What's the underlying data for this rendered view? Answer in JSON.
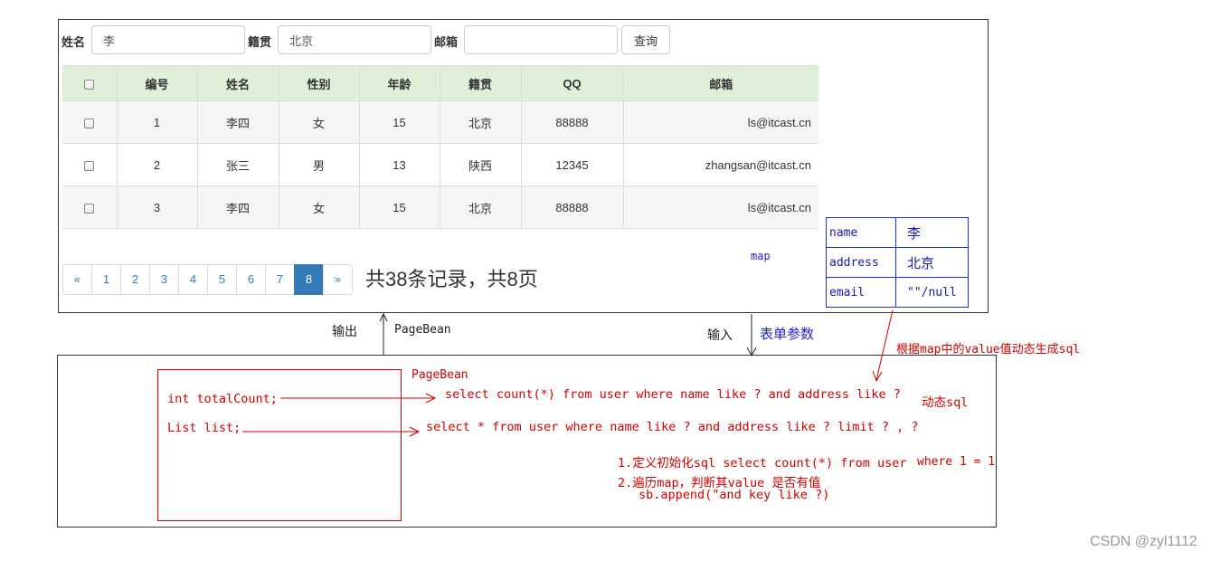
{
  "search": {
    "name_label": "姓名",
    "name_value": "李",
    "address_label": "籍贯",
    "address_value": "北京",
    "email_label": "邮箱",
    "email_value": "",
    "query_button": "查询"
  },
  "table": {
    "headers": [
      "编号",
      "姓名",
      "性别",
      "年龄",
      "籍贯",
      "QQ",
      "邮箱"
    ],
    "rows": [
      [
        "1",
        "李四",
        "女",
        "15",
        "北京",
        "88888",
        "ls@itcast.cn"
      ],
      [
        "2",
        "张三",
        "男",
        "13",
        "陕西",
        "12345",
        "zhangsan@itcast.cn"
      ],
      [
        "3",
        "李四",
        "女",
        "15",
        "北京",
        "88888",
        "ls@itcast.cn"
      ]
    ]
  },
  "pagination": {
    "prev": "«",
    "pages": [
      "1",
      "2",
      "3",
      "4",
      "5",
      "6",
      "7",
      "8"
    ],
    "active_page": "8",
    "next": "»",
    "summary": "共38条记录，共8页"
  },
  "map": {
    "label": "map",
    "rows": [
      {
        "key": "name",
        "value": "李"
      },
      {
        "key": "address",
        "value": "北京"
      },
      {
        "key": "email",
        "value": "\"\"/null"
      }
    ]
  },
  "connectors": {
    "output_label": "输出",
    "pagebean_label": "PageBean",
    "input_label": "输入",
    "form_params_label": "表单参数",
    "dynamic_note": "根据map中的value值动态生成sql"
  },
  "server": {
    "pagebean_title": "PageBean",
    "field_total": "int totalCount;",
    "field_list": "List list;",
    "sql_count": "select count(*) from user where name like ? and address like ?",
    "sql_list": "select * from user where name like ? and address like ? limit ? , ?",
    "dynamic_sql_label": "动态sql",
    "step1": "1.定义初始化sql select count(*) from user",
    "step1_where": "where 1 = 1",
    "step2": "2.遍历map，判断其value 是否有值",
    "step3": "sb.append(\"and  key like ?)"
  },
  "watermark": "CSDN @zyl1112",
  "colors": {
    "header_bg": "#dff0d8",
    "stripe_bg": "#f5f5f5",
    "page_active": "#337ab7",
    "annotation_red": "#d00000",
    "annotation_blue": "#1f1fd8"
  }
}
